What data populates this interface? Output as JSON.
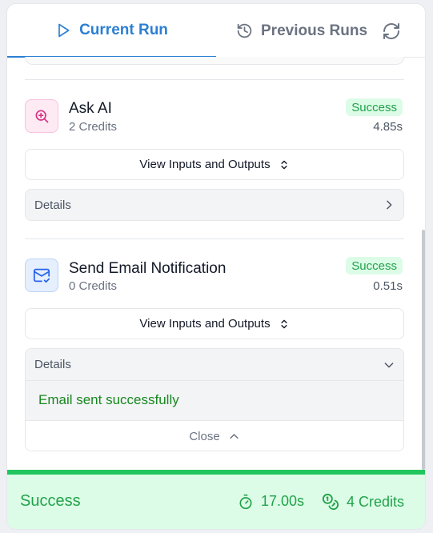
{
  "tabs": {
    "current": "Current Run",
    "previous": "Previous Runs"
  },
  "steps": [
    {
      "title": "Ask AI",
      "credits": "2 Credits",
      "status": "Success",
      "duration": "4.85s",
      "icon": "zoom-in-icon",
      "view_io_label": "View Inputs and Outputs",
      "details_label": "Details"
    },
    {
      "title": "Send Email Notification",
      "credits": "0 Credits",
      "status": "Success",
      "duration": "0.51s",
      "icon": "mail-check-icon",
      "view_io_label": "View Inputs and Outputs",
      "details_label": "Details",
      "details_output": "Email sent successfully",
      "close_label": "Close"
    }
  ],
  "footer": {
    "status": "Success",
    "time": "17.00s",
    "credits": "4 Credits"
  },
  "colors": {
    "accent": "#2b7fd4",
    "success": "#22a24a",
    "success_bg": "#dcfce7",
    "success_bar": "#22c55e"
  }
}
